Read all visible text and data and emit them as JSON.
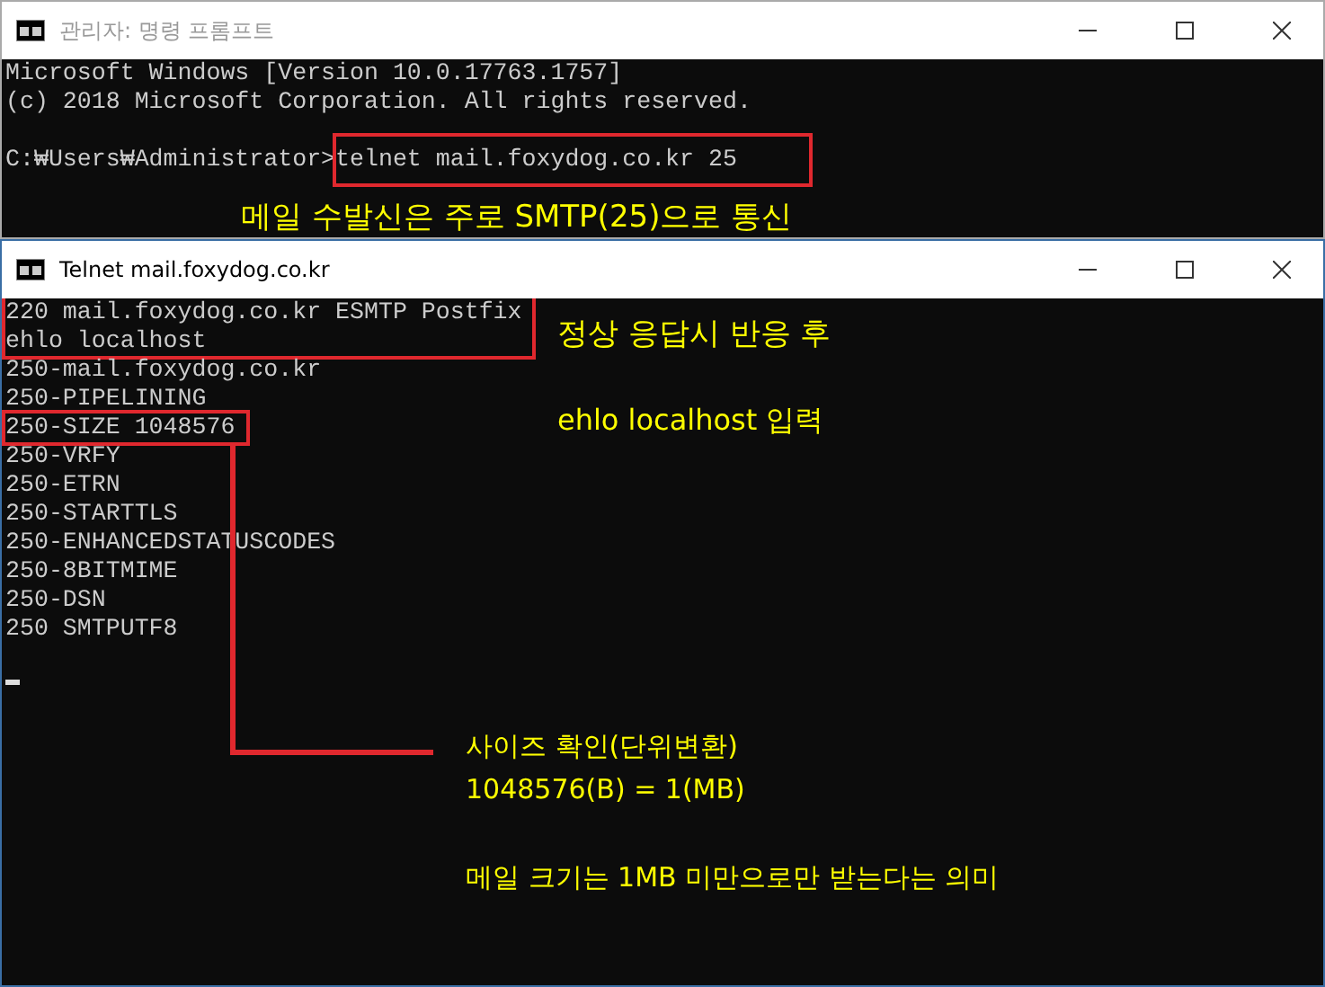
{
  "windows": [
    {
      "title": "관리자: 명령 프롬프트",
      "active": false,
      "blocks": [
        {
          "framed": false,
          "lines": [
            "Microsoft Windows [Version 10.0.17763.1757]",
            "(c) 2018 Microsoft Corporation. All rights reserved."
          ]
        }
      ],
      "prompt_line": {
        "prompt": "C:₩Users₩Administrator>",
        "command": "telnet mail.foxydog.co.kr 25",
        "framed": true
      },
      "annotations": [
        "메일 수발신은 주로 SMTP(25)으로 통신"
      ]
    },
    {
      "title": "Telnet mail.foxydog.co.kr",
      "active": true,
      "blocks": [
        {
          "framed": true,
          "lines": [
            "220 mail.foxydog.co.kr ESMTP Postfix",
            "ehlo localhost"
          ]
        },
        {
          "framed": false,
          "lines": [
            "250-mail.foxydog.co.kr",
            "250-PIPELINING"
          ]
        },
        {
          "framed": true,
          "lines": [
            "250-SIZE 1048576"
          ]
        },
        {
          "framed": false,
          "lines": [
            "250-VRFY",
            "250-ETRN",
            "250-STARTTLS",
            "250-ENHANCEDSTATUSCODES",
            "250-8BITMIME",
            "250-DSN",
            "250 SMTPUTF8"
          ]
        }
      ],
      "cursor": true,
      "annotations": [
        "정상 응답시 반응 후",
        "ehlo localhost 입력",
        "사이즈 확인(단위변환)",
        "1048576(B) = 1(MB)",
        "메일 크기는 1MB 미만으로만 받는다는 의미"
      ]
    }
  ]
}
